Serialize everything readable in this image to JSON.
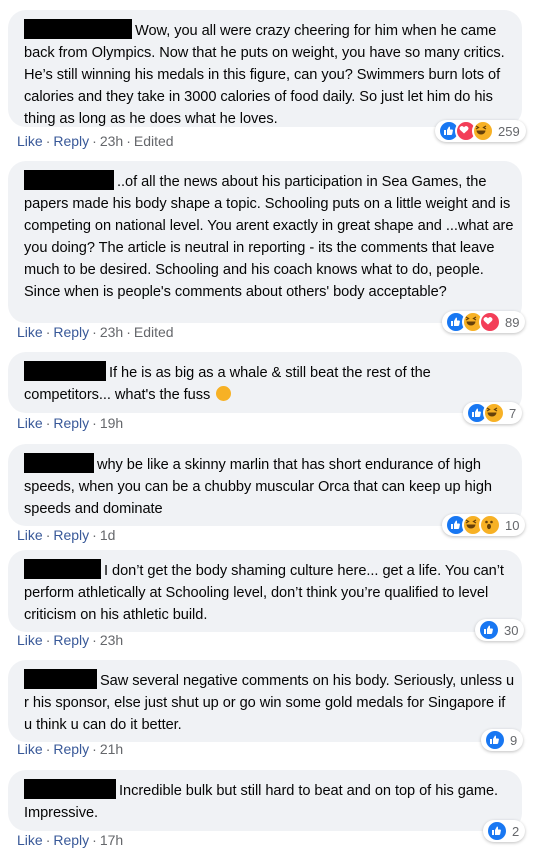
{
  "comments": [
    {
      "text": "Wow, you all were crazy cheering for him when he came back from Olympics. Now that he puts on weight, you have so many critics. He’s still winning his medals in this figure, can you? Swimmers burn lots of calories and they take in 3000 calories of food daily. So just let him do his thing as long as he does what he loves.",
      "like": "Like",
      "reply": "Reply",
      "time": "23h",
      "edited": "Edited",
      "reactions": [
        "like-icon",
        "love-icon",
        "haha-icon"
      ],
      "count": "259"
    },
    {
      "text": "..of all the news about his participation in Sea Games, the papers made his body shape a topic. Schooling puts on a little weight and is competing on national level. You arent exactly in great shape and ...what are you doing? The article is neutral in reporting - its the comments that leave much to be desired. Schooling and his coach knows what to do, people. Since when is people's comments about others' body acceptable?",
      "like": "Like",
      "reply": "Reply",
      "time": "23h",
      "edited": "Edited",
      "reactions": [
        "like-icon",
        "haha-icon",
        "love-icon"
      ],
      "count": "89"
    },
    {
      "text": "If he is as big as a whale & still beat the rest of the competitors... what's the fuss",
      "like": "Like",
      "reply": "Reply",
      "time": "19h",
      "reactions": [
        "like-icon",
        "haha-icon"
      ],
      "count": "7"
    },
    {
      "text": "why be like a skinny marlin that has short endurance of high speeds, when you can be a chubby muscular Orca that can keep up high speeds and dominate",
      "like": "Like",
      "reply": "Reply",
      "time": "1d",
      "reactions": [
        "like-icon",
        "haha-icon",
        "wow-icon"
      ],
      "count": "10"
    },
    {
      "text": "I don’t get the body shaming culture here... get a life. You can’t perform athletically at Schooling level, don’t think you’re qualified to level criticism on his athletic build.",
      "like": "Like",
      "reply": "Reply",
      "time": "23h",
      "reactions": [
        "like-icon"
      ],
      "count": "30"
    },
    {
      "text": "Saw several negative comments on his body. Seriously, unless u r his sponsor, else just shut up or go win some gold medals for Singapore if u think u can do it better.",
      "like": "Like",
      "reply": "Reply",
      "time": "21h",
      "reactions": [
        "like-icon"
      ],
      "count": "9"
    },
    {
      "text": "Incredible bulk but still hard to beat and on top of his game. Impressive.",
      "like": "Like",
      "reply": "Reply",
      "time": "17h",
      "reactions": [
        "like-icon"
      ],
      "count": "2"
    }
  ],
  "colors": {
    "bubble": "#f0f2f5",
    "link": "#385898",
    "meta": "#65676b",
    "like": "#1877f2",
    "love": "#f33e58",
    "haha": "#f7b125"
  }
}
